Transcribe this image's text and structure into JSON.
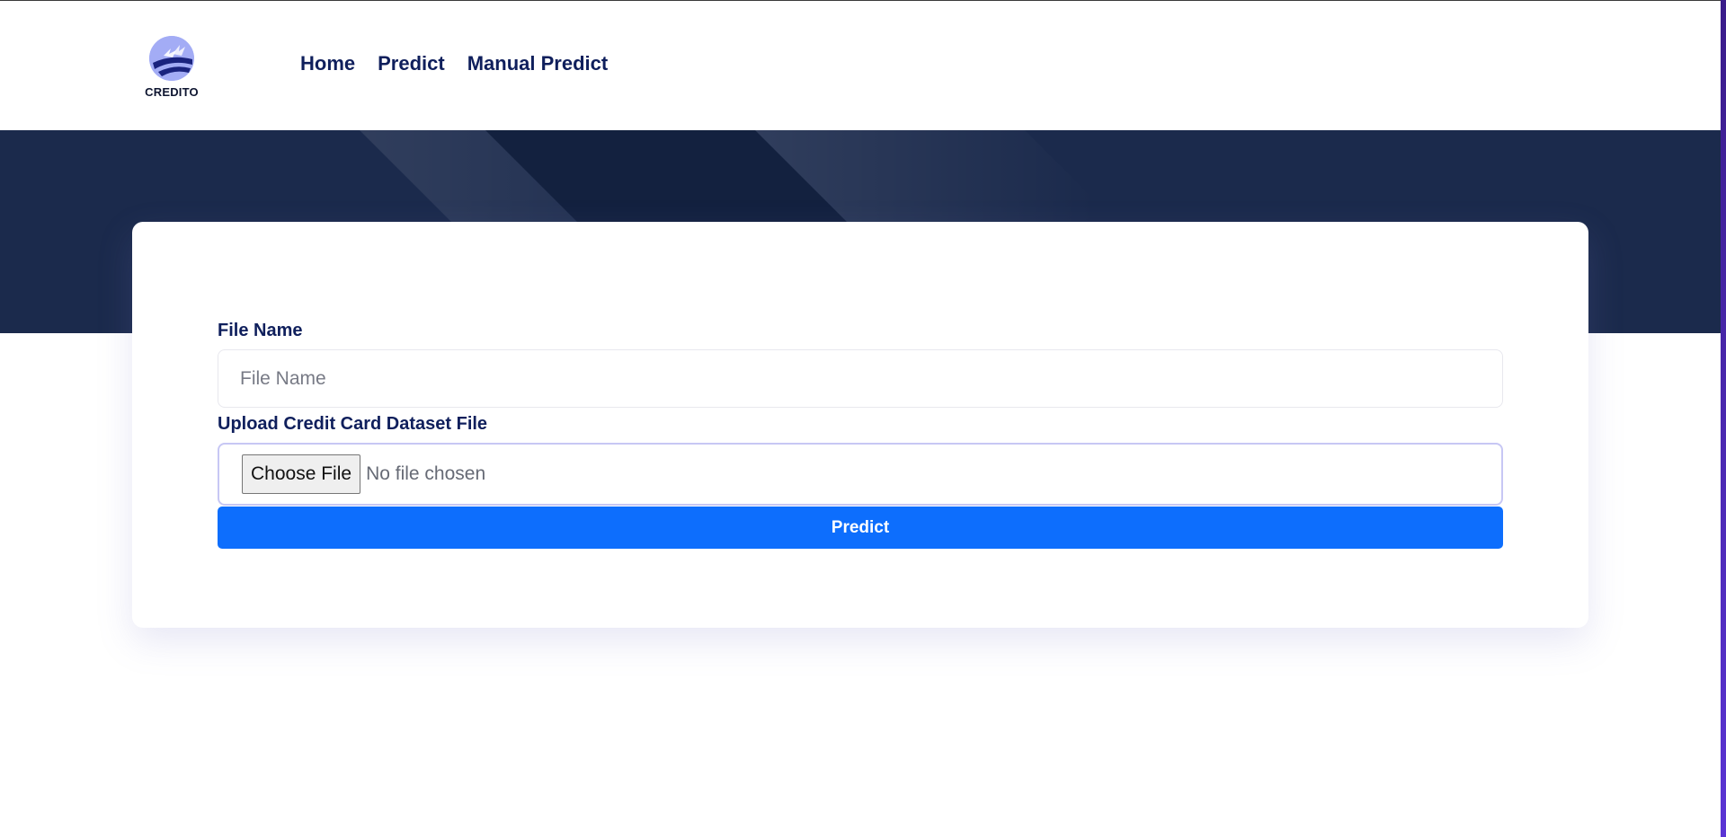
{
  "brand": {
    "name": "CREDITO"
  },
  "nav": {
    "items": [
      {
        "label": "Home"
      },
      {
        "label": "Predict"
      },
      {
        "label": "Manual Predict"
      }
    ]
  },
  "form": {
    "file_name": {
      "label": "File Name",
      "placeholder": "File Name",
      "value": ""
    },
    "upload": {
      "label": "Upload Credit Card Dataset File",
      "button_label": "Choose File",
      "status": "No file chosen"
    },
    "submit_label": "Predict"
  },
  "colors": {
    "nav_text": "#0f1f5c",
    "hero_bg": "#1b2a4c",
    "primary_button": "#0d6efd",
    "scrollbar_thumb": "#5b35d5"
  },
  "icons": {
    "logo": "credito-globe-logo"
  }
}
